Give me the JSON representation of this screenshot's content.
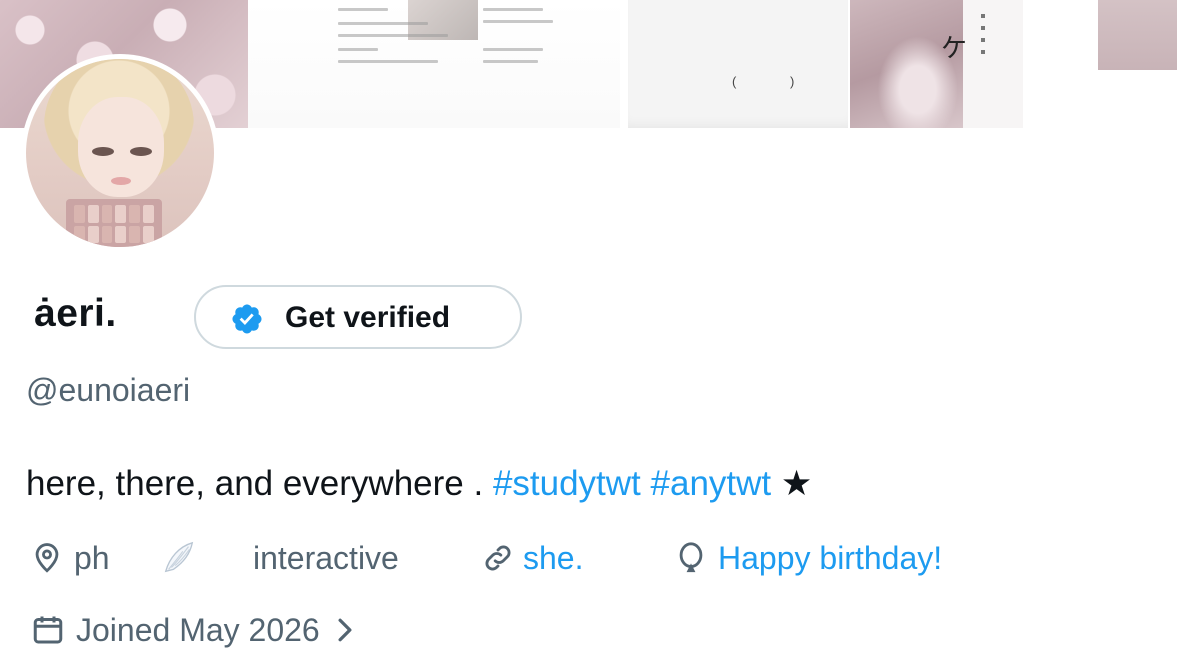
{
  "banner": {
    "card_left_paren": "(",
    "card_right_paren": ")",
    "vertical_glyph": "ケ"
  },
  "profile": {
    "display_name": "ȧeri.",
    "verify_label": "Get verified",
    "handle": "@eunoiaeri"
  },
  "bio": {
    "text": "here, there, and everywhere . ",
    "tag1": "#studytwt",
    "tag2": "#anytwt",
    "star": "★"
  },
  "meta": {
    "location": "ph",
    "wings_emoji": "🪽",
    "professional": "interactive",
    "link": "she.",
    "birthday": "Happy birthday!",
    "joined": "Joined May 2026"
  },
  "colors": {
    "accent": "#1d9bf0",
    "muted": "#536471",
    "text": "#0f1419",
    "border": "#cfd9de"
  },
  "icons": [
    "location-pin-icon",
    "wing-icon",
    "link-icon",
    "balloon-icon",
    "calendar-icon",
    "chevron-right-icon",
    "verified-badge-icon"
  ]
}
